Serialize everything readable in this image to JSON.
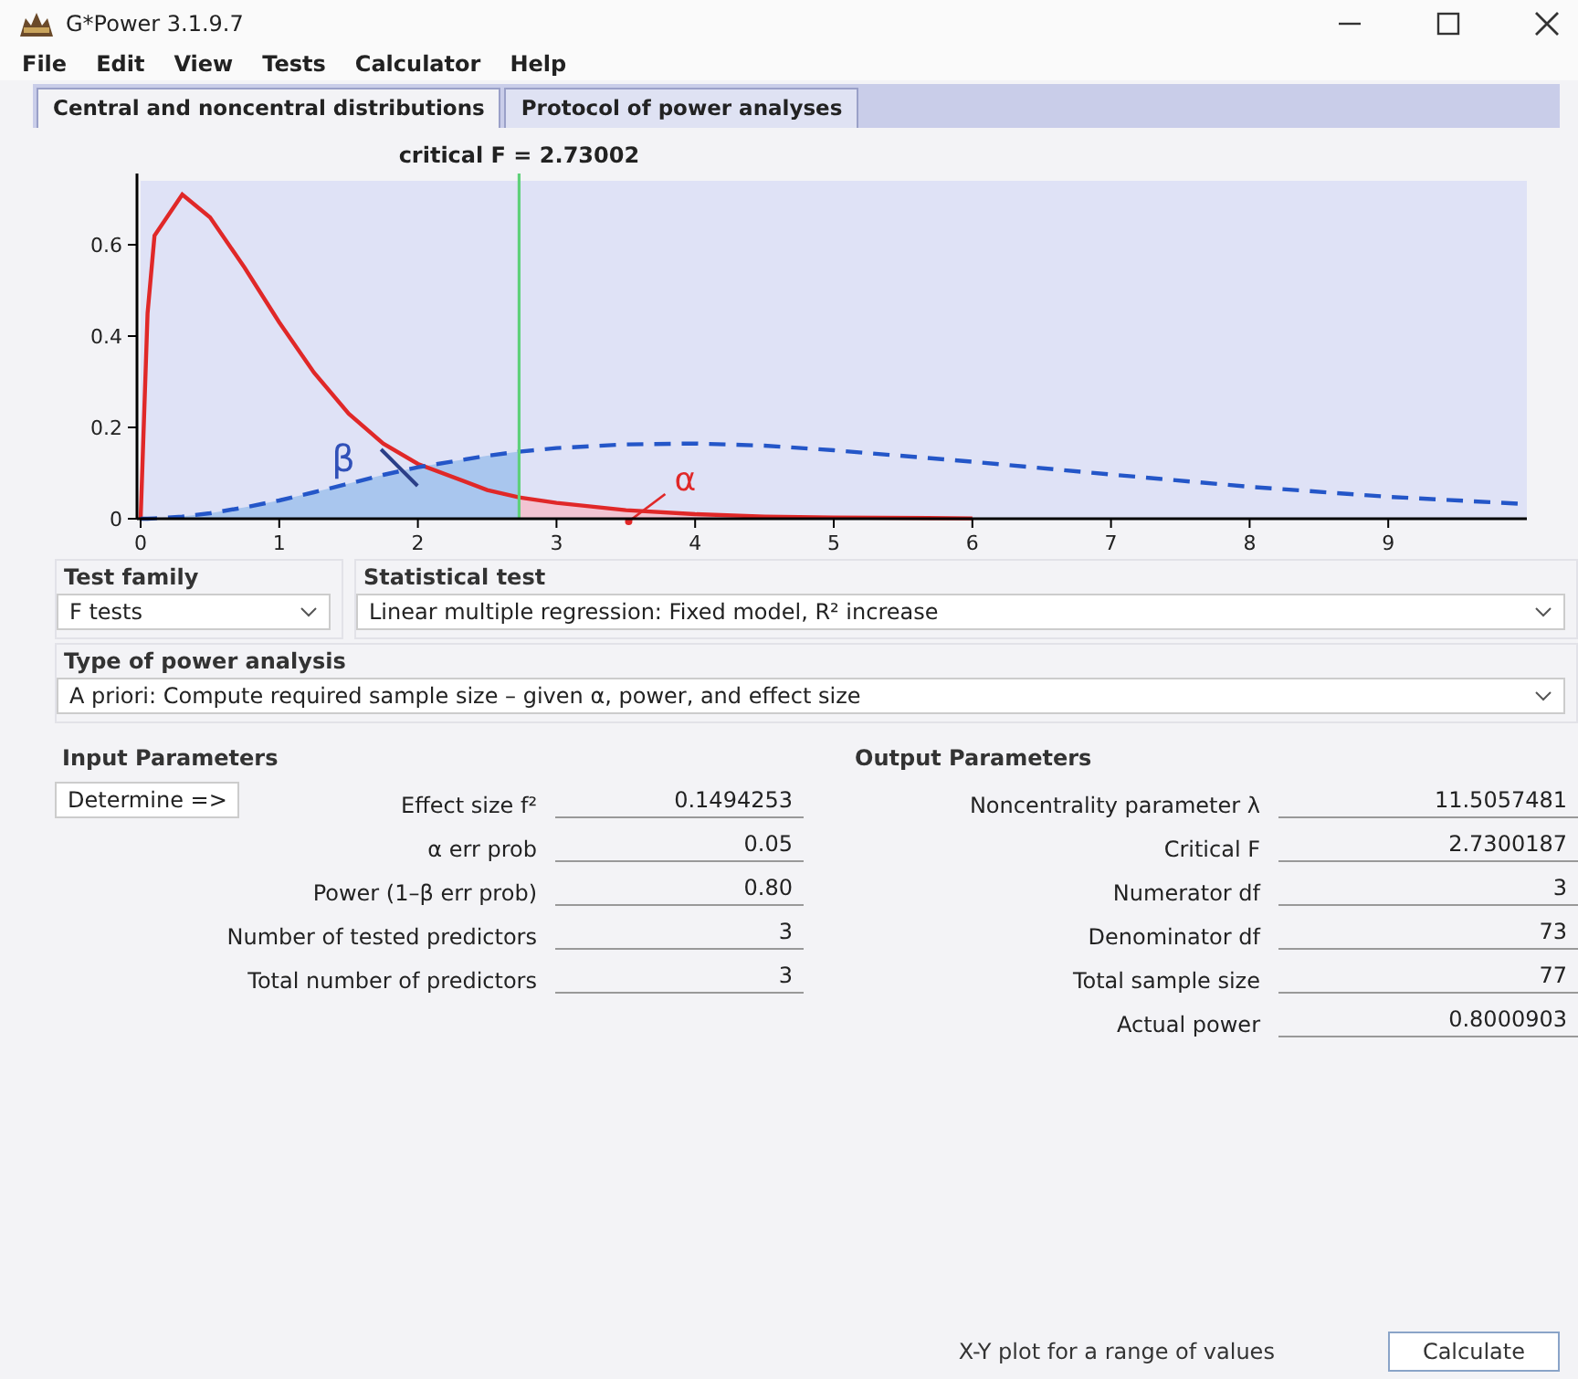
{
  "window": {
    "title": "G*Power 3.1.9.7"
  },
  "menu": [
    "File",
    "Edit",
    "View",
    "Tests",
    "Calculator",
    "Help"
  ],
  "tabs": [
    {
      "label": "Central and noncentral distributions",
      "selected": true
    },
    {
      "label": "Protocol of power analyses",
      "selected": false
    }
  ],
  "chart": {
    "critical_label": "critical F = 2.73002",
    "beta_label": "β",
    "alpha_label": "α",
    "chart_data": {
      "type": "line",
      "x": [
        0,
        0.05,
        0.1,
        0.3,
        0.5,
        0.75,
        1,
        1.25,
        1.5,
        1.75,
        2,
        2.5,
        2.73,
        3,
        3.5,
        4,
        4.5,
        5,
        6,
        7,
        8,
        9,
        10
      ],
      "series": [
        {
          "color": "#e02828",
          "line_style": "solid",
          "values": [
            0,
            0.45,
            0.62,
            0.71,
            0.66,
            0.55,
            0.43,
            0.32,
            0.23,
            0.165,
            0.12,
            0.063,
            0.047,
            0.035,
            0.019,
            0.01,
            0.005,
            0.003,
            0.001,
            null,
            null,
            null,
            null
          ]
        },
        {
          "color": "#2456c8",
          "line_style": "dashed",
          "values": [
            0,
            0,
            0.001,
            0.005,
            0.012,
            0.025,
            0.04,
            0.058,
            0.077,
            0.096,
            0.113,
            0.138,
            0.147,
            0.155,
            0.163,
            0.165,
            0.16,
            0.15,
            0.125,
            0.097,
            0.07,
            0.048,
            0.032
          ]
        }
      ],
      "xlim": [
        0,
        10
      ],
      "ylim": [
        0,
        0.74
      ],
      "xticks": [
        0,
        1,
        2,
        3,
        4,
        5,
        6,
        7,
        8,
        9
      ],
      "yticks": [
        0,
        0.2,
        0.4,
        0.6
      ],
      "ref_lines": [
        {
          "axis": "x",
          "value": 2.73002,
          "color": "#5fd07a"
        }
      ]
    }
  },
  "test_family": {
    "label": "Test family",
    "value": "F tests"
  },
  "statistical_test": {
    "label": "Statistical test",
    "value": "Linear multiple regression: Fixed model, R² increase"
  },
  "analysis_type": {
    "label": "Type of power analysis",
    "value": "A priori: Compute required sample size – given α, power, and effect size"
  },
  "input": {
    "title": "Input Parameters",
    "button": "Determine =>",
    "rows": [
      {
        "label": "Effect size f²",
        "value": "0.1494253"
      },
      {
        "label": "α err prob",
        "value": "0.05"
      },
      {
        "label": "Power (1–β err prob)",
        "value": "0.80"
      },
      {
        "label": "Number of tested predictors",
        "value": "3"
      },
      {
        "label": "Total number of predictors",
        "value": "3"
      }
    ]
  },
  "output": {
    "title": "Output Parameters",
    "rows": [
      {
        "label": "Noncentrality parameter λ",
        "value": "11.5057481"
      },
      {
        "label": "Critical F",
        "value": "2.7300187"
      },
      {
        "label": "Numerator df",
        "value": "3"
      },
      {
        "label": "Denominator df",
        "value": "73"
      },
      {
        "label": "Total sample size",
        "value": "77"
      },
      {
        "label": "Actual power",
        "value": "0.8000903"
      }
    ]
  },
  "footer": {
    "plot_button": "X-Y plot for a range of values",
    "calculate_button": "Calculate"
  }
}
